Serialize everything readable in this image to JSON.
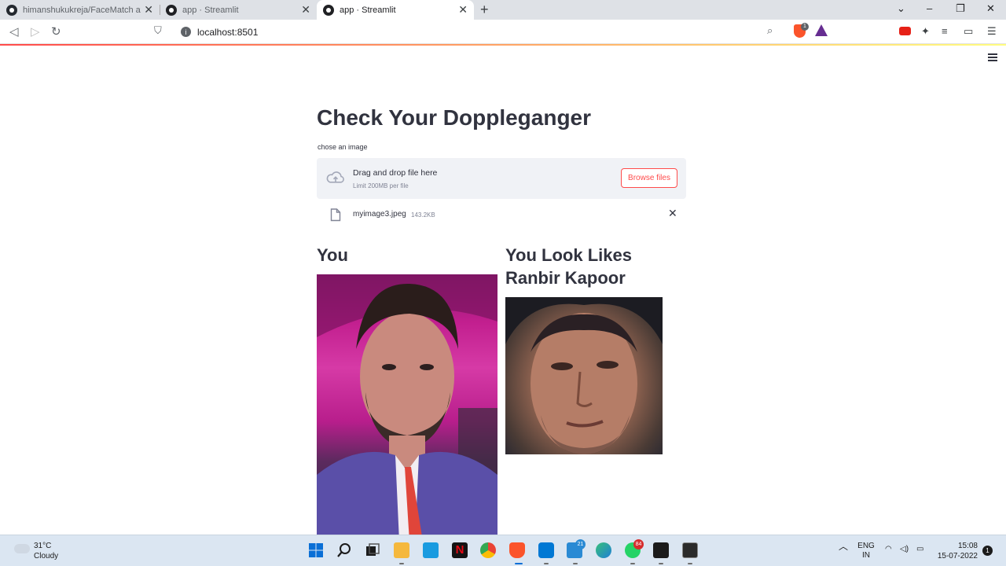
{
  "browser": {
    "tabs": [
      {
        "title": "himanshukukreja/FaceMatch at mas",
        "close": "✕"
      },
      {
        "title": "app · Streamlit",
        "close": "✕"
      },
      {
        "title": "app · Streamlit",
        "close": "✕"
      }
    ],
    "new_tab": "+",
    "url": "localhost:8501",
    "brave_badge": "1"
  },
  "app": {
    "title": "Check Your Doppleganger",
    "uploader_label": "chose an image",
    "dropzone_title": "Drag and drop file here",
    "dropzone_limit": "Limit 200MB per file",
    "browse_label": "Browse files",
    "file_name": "myimage3.jpeg",
    "file_size": "143.2KB",
    "file_close": "✕",
    "col1_heading": "You",
    "col2_heading": "You Look Likes Ranbir Kapoor"
  },
  "taskbar": {
    "temperature": "31°C",
    "condition": "Cloudy",
    "mail_badge": "21",
    "whatsapp_badge": "84",
    "lang_1": "ENG",
    "lang_2": "IN",
    "time": "15:08",
    "date": "15-07-2022",
    "notifications": "1"
  },
  "colors": {
    "accent": "#ff4b4b",
    "text": "#31333f",
    "dropzone_bg": "#f0f2f6",
    "taskbar_bg": "#dbe6f2"
  }
}
